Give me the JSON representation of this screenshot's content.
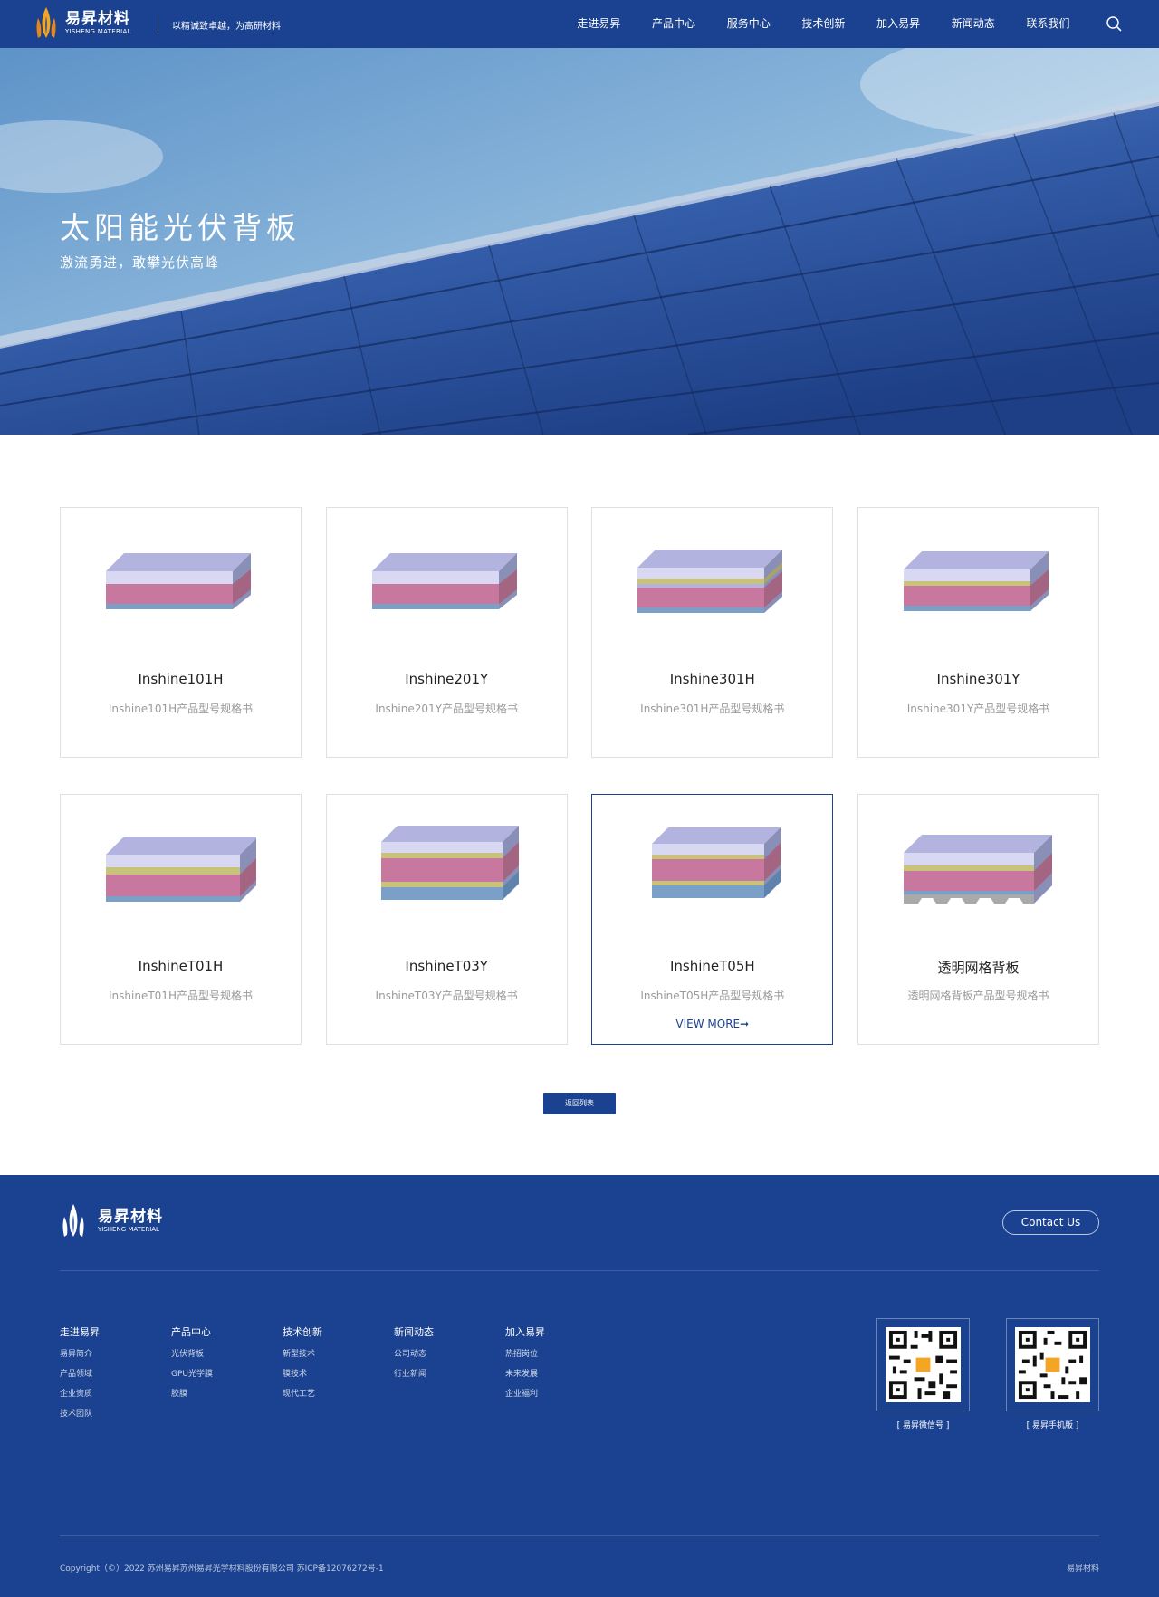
{
  "header": {
    "logo_cn": "易昇材料",
    "logo_en": "YISHENG MATERIAL",
    "slogan": "以精诚致卓越，为高研材料",
    "nav": [
      "走进易昇",
      "产品中心",
      "服务中心",
      "技术创新",
      "加入易昇",
      "新闻动态",
      "联系我们"
    ]
  },
  "banner": {
    "title": "太阳能光伏背板",
    "subtitle": "激流勇进，敢攀光伏高峰"
  },
  "products": [
    {
      "name": "Inshine101H",
      "desc": "Inshine101H产品型号规格书"
    },
    {
      "name": "Inshine201Y",
      "desc": "Inshine201Y产品型号规格书"
    },
    {
      "name": "Inshine301H",
      "desc": "Inshine301H产品型号规格书"
    },
    {
      "name": "Inshine301Y",
      "desc": "Inshine301Y产品型号规格书"
    },
    {
      "name": "InshineT01H",
      "desc": "InshineT01H产品型号规格书"
    },
    {
      "name": "InshineT03Y",
      "desc": "InshineT03Y产品型号规格书"
    },
    {
      "name": "InshineT05H",
      "desc": "InshineT05H产品型号规格书",
      "more": "VIEW MORE➞"
    },
    {
      "name": "透明网格背板",
      "desc": "透明网格背板产品型号规格书"
    }
  ],
  "back_button": "返回列表",
  "footer": {
    "logo_cn": "易昇材料",
    "logo_en": "YISHENG MATERIAL",
    "contact": "Contact Us",
    "columns": [
      {
        "title": "走进易昇",
        "links": [
          "易昇简介",
          "产品领域",
          "企业资质",
          "技术团队"
        ]
      },
      {
        "title": "产品中心",
        "links": [
          "光伏背板",
          "GPU光学膜",
          "胶膜"
        ]
      },
      {
        "title": "技术创新",
        "links": [
          "新型技术",
          "膜技术",
          "现代工艺"
        ]
      },
      {
        "title": "新闻动态",
        "links": [
          "公司动态",
          "行业新闻"
        ]
      },
      {
        "title": "加入易昇",
        "links": [
          "热招岗位",
          "未来发展",
          "企业福利"
        ]
      }
    ],
    "qr": [
      "[ 易昇微信号 ]",
      "[ 易昇手机版 ]"
    ],
    "copyright": "Copyright（©）2022  苏州易昇苏州易昇光学材料股份有限公司  苏ICP备12076272号-1",
    "right_text": "易昇材料"
  },
  "colors": {
    "primary": "#1b4290",
    "layer_top": "#b3b3e0",
    "layer_pink": "#c8789e",
    "layer_yellow": "#c9c27a",
    "layer_blue": "#7ba0c8"
  }
}
